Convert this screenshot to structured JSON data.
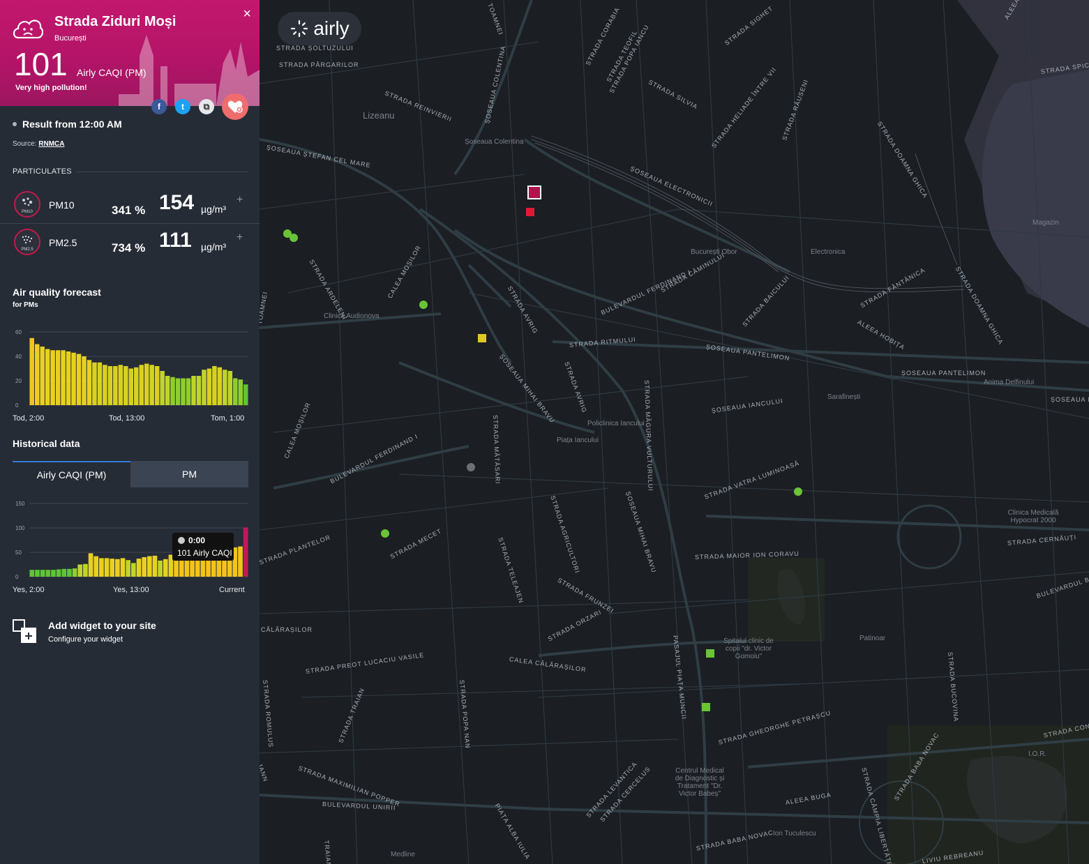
{
  "header": {
    "location_name": "Strada Ziduri Moși",
    "city": "București",
    "caqi_value": "101",
    "caqi_unit": "Airly CAQI (PM)",
    "description": "Very high pollution!",
    "close_label": "×",
    "header_color": "#b8156a"
  },
  "social": {
    "facebook": "f",
    "twitter": "t",
    "copy": "⧉"
  },
  "result": {
    "label": "Result from 12:00 AM",
    "source_prefix": "Source:",
    "source_name": "RNMCA"
  },
  "particulates": {
    "section_label": "PARTICULATES",
    "items": [
      {
        "name": "PM10",
        "icon_label": "PM10",
        "percent": "341 %",
        "value": "154",
        "unit": "µg/m³",
        "plus": "+"
      },
      {
        "name": "PM2.5",
        "icon_label": "PM2.5",
        "percent": "734 %",
        "value": "111",
        "unit": "µg/m³",
        "plus": "+"
      }
    ]
  },
  "forecast": {
    "title": "Air quality forecast",
    "subtitle": "for PMs"
  },
  "historical": {
    "title": "Historical data",
    "tabs": [
      "Airly CAQI (PM)",
      "PM"
    ],
    "active_tab": 0,
    "tooltip_time": "0:00",
    "tooltip_value": "101 Airly CAQI"
  },
  "widget": {
    "title": "Add widget to your site",
    "subtitle": "Configure your widget"
  },
  "map": {
    "logo_text": "airly",
    "streets": [
      {
        "t": "STRADA ȘOLTUZULUI"
      },
      {
        "t": "STRADA PÂRGARILOR"
      },
      {
        "t": "STRADA REINVIERII"
      },
      {
        "t": "ȘOSEAUA COLENTINA"
      },
      {
        "t": "STRADA CORABIA"
      },
      {
        "t": "STRADA TEOFIL"
      },
      {
        "t": "STRADA POPA IANCU"
      },
      {
        "t": "STRADA SIGHET"
      },
      {
        "t": "STRADA SILVIA"
      },
      {
        "t": "STRADA HELIADE ÎNTRE VII"
      },
      {
        "t": "STRADA RĂUSENI"
      },
      {
        "t": "STRADA DOAMNA GHICA"
      },
      {
        "t": "STRADA SPICUL"
      },
      {
        "t": "ȘOSEAUA ȘTEFAN CEL MARE"
      },
      {
        "t": "ȘOSEAUA ELECTRONICII"
      },
      {
        "t": "STRADA ARDELENI"
      },
      {
        "t": "CALEA MOȘILOR"
      },
      {
        "t": "STRADA AVRIG"
      },
      {
        "t": "BULEVARDUL FERDINAND I"
      },
      {
        "t": "STRADA CĂMINULUI"
      },
      {
        "t": "STRADA BAICULUI"
      },
      {
        "t": "STRADA FÂNTÂNICA"
      },
      {
        "t": "ALEEA HOBIȚA"
      },
      {
        "t": "STRADA DOAMNA GHICA"
      },
      {
        "t": "STRADA RITMULUI"
      },
      {
        "t": "ȘOSEAUA PANTELIMON"
      },
      {
        "t": "ȘOSEAUA MIHAI BRAVU"
      },
      {
        "t": "STRADA AVRIG"
      },
      {
        "t": "ȘOSEAUA PANTELIMON"
      },
      {
        "t": "ȘOSEAUA IANCULUI"
      },
      {
        "t": "STRADA MĂGURA VULTURULUI"
      },
      {
        "t": "CALEA MOȘILOR"
      },
      {
        "t": "BULEVARDUL FERDINAND I"
      },
      {
        "t": "STRADA MĂTĂSARI"
      },
      {
        "t": "STRADA VATRA LUMINOASĂ"
      },
      {
        "t": "ȘOSEAUA MIHAI BRAVU"
      },
      {
        "t": "STRADA AGRICULTORI"
      },
      {
        "t": "STRADA PLANTELOR"
      },
      {
        "t": "STRADA MECET"
      },
      {
        "t": "STRADA TELEAJEN"
      },
      {
        "t": "STRADA FRUNZEI"
      },
      {
        "t": "STRADA MAIOR ION CORAVU"
      },
      {
        "t": "STRADA CERNĂUȚI"
      },
      {
        "t": "BULEVARDUL BA"
      },
      {
        "t": "CĂLĂRAȘILOR"
      },
      {
        "t": "STRADA ORZARI"
      },
      {
        "t": "STRADA PREOT LUCACIU VASILE"
      },
      {
        "t": "CALEA CĂLĂRAȘILOR"
      },
      {
        "t": "PASAJUL PIAȚA MUNCII"
      },
      {
        "t": "STRADA TRAIAN"
      },
      {
        "t": "STRADA POPA NAN"
      },
      {
        "t": "STRADA ROMULUS"
      },
      {
        "t": "STRADA GHEORGHE PETRAȘCU"
      },
      {
        "t": "STRADA BUCOVINA"
      },
      {
        "t": "STRADA MAXIMILIAN POPPER"
      },
      {
        "t": "BULEVARDUL UNIRII"
      },
      {
        "t": "PIAȚA ALBA IULIA"
      },
      {
        "t": "STRADA LEVANTICA"
      },
      {
        "t": "STRADA CERCELUS"
      },
      {
        "t": "ALEEA BUGA"
      },
      {
        "t": "STRADA BABA NOVAC"
      },
      {
        "t": "STRADA BABA NOVAC"
      },
      {
        "t": "STRADA CÂMPIA LIBERTĂȚII"
      },
      {
        "t": "STRADA CONS"
      },
      {
        "t": "TRAIAN"
      },
      {
        "t": "ȘOSEAUA PA"
      },
      {
        "t": "LIVIU REBREANU"
      },
      {
        "t": "TOAMNEI"
      },
      {
        "t": "TOAMNEI"
      },
      {
        "t": "ALEEA"
      },
      {
        "t": "JANN"
      }
    ],
    "pois": [
      "Lizeanu",
      "Șoseaua Colentina",
      "Clinica Audionova",
      "București Obor",
      "Electronica",
      "Magazin",
      "Anima Delfinului",
      "Sarafinești",
      "Policlinica Iancului",
      "Piața Iancului",
      "Clinica Medicală Hypocrat 2000",
      "Spitalul clinic de copii \"dr. Victor Gomoiu\"",
      "Patinoar",
      "Centrul Medical de Diagnostic și Tratament \"Dr. Victor Babeș\"",
      "Ion Tuculescu",
      "I.O.R.",
      "Medline"
    ]
  },
  "chart_data": [
    {
      "type": "bar",
      "title": "Air quality forecast",
      "subtitle": "for PMs",
      "x_labels": [
        "Tod, 2:00",
        "Tod, 13:00",
        "Tom, 1:00"
      ],
      "y_ticks": [
        0,
        20,
        40,
        60
      ],
      "ylim": [
        0,
        60
      ],
      "values": [
        55,
        50,
        48,
        46,
        45,
        45,
        45,
        44,
        43,
        42,
        40,
        37,
        35,
        35,
        33,
        32,
        32,
        33,
        32,
        30,
        31,
        33,
        34,
        33,
        32,
        28,
        24,
        23,
        22,
        22,
        22,
        24,
        24,
        29,
        30,
        32,
        31,
        29,
        28,
        22,
        21,
        17
      ],
      "colors": [
        "#f5c41a",
        "#e8d11f",
        "#d9d11f",
        "#c0d42a",
        "#8fcf2c",
        "#5fc534"
      ]
    },
    {
      "type": "bar",
      "title": "Historical data",
      "x_labels": [
        "Yes, 2:00",
        "Yes, 13:00",
        "Current"
      ],
      "y_ticks": [
        0,
        50,
        100,
        150
      ],
      "ylim": [
        0,
        150
      ],
      "values": [
        14,
        14,
        14,
        14,
        14,
        15,
        16,
        16,
        17,
        25,
        26,
        48,
        42,
        38,
        38,
        37,
        36,
        38,
        34,
        28,
        37,
        40,
        42,
        43,
        33,
        36,
        45,
        53,
        52,
        54,
        56,
        60,
        60,
        59,
        58,
        58,
        58,
        58,
        60,
        62,
        101
      ],
      "colors": [
        "#5fc534",
        "#8fcf2c",
        "#c0d42a",
        "#e8d11f",
        "#f5c41a",
        "#c2185b"
      ]
    }
  ]
}
